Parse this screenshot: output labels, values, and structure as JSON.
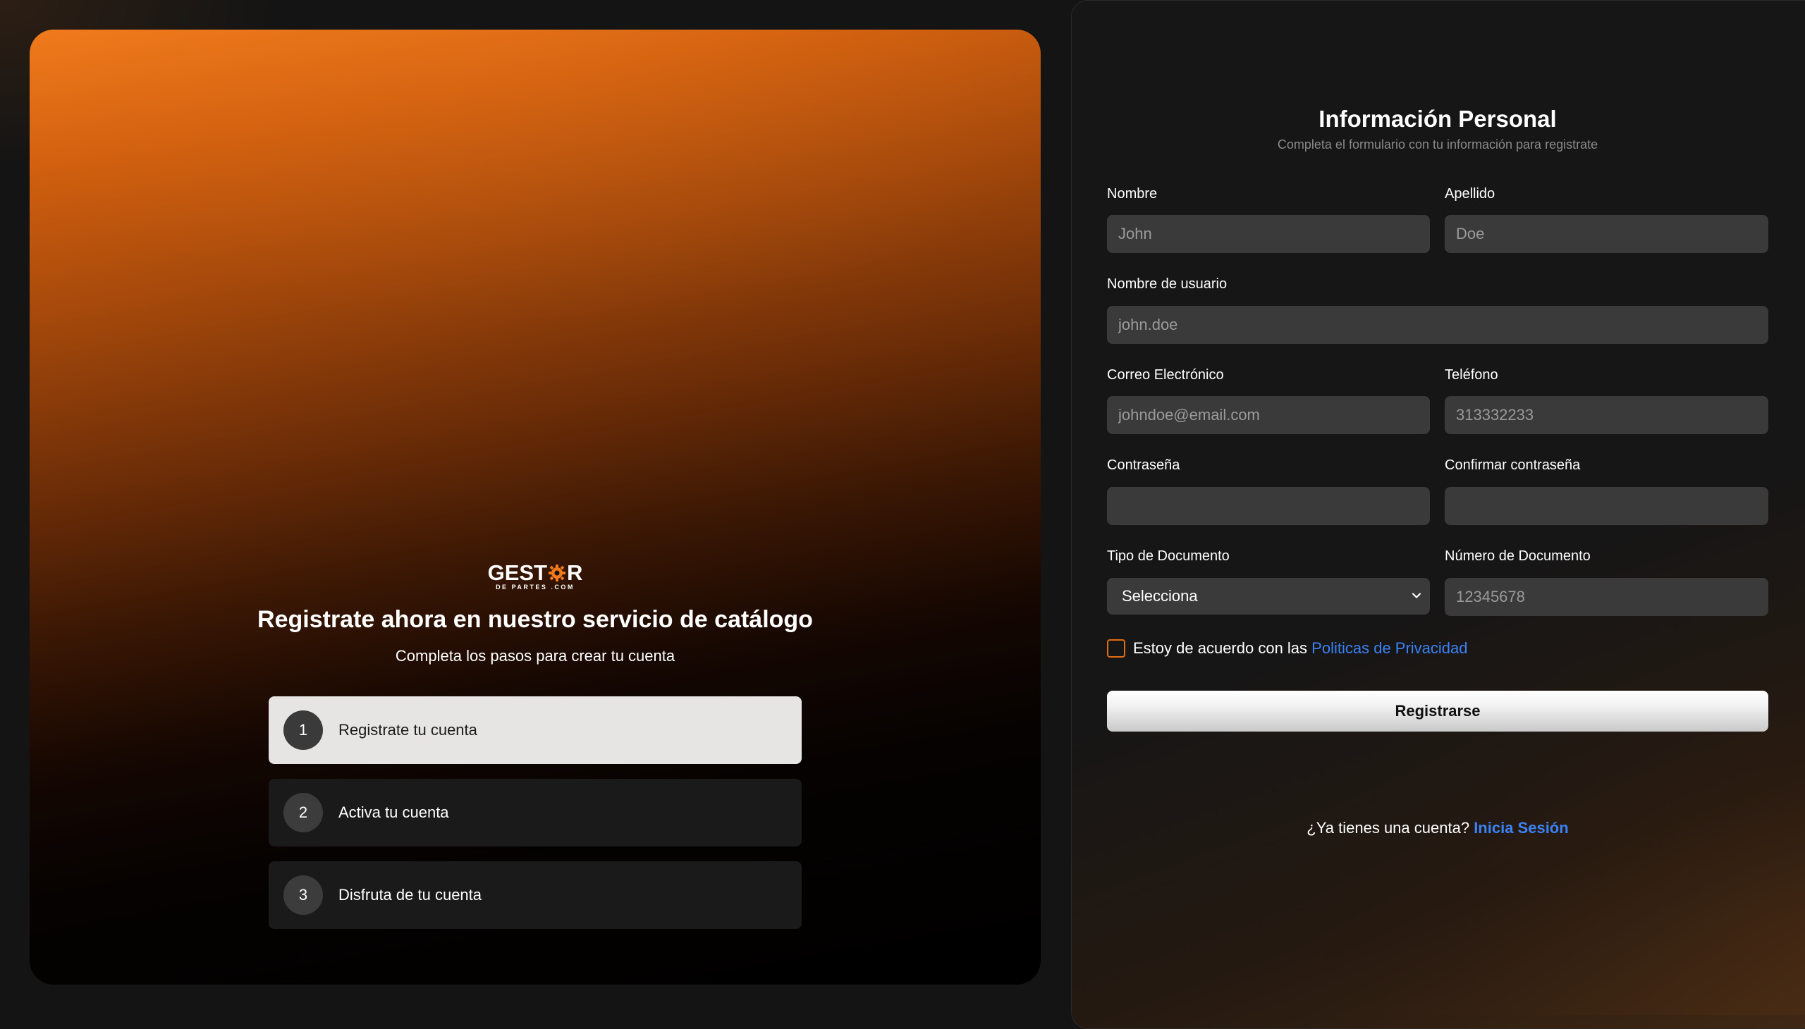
{
  "hero": {
    "logo_text": "GESTOR",
    "logo_sub": "DE PARTES .COM",
    "title": "Registrate ahora en nuestro servicio de catálogo",
    "subtitle": "Completa los pasos para crear tu cuenta",
    "steps": [
      {
        "num": "1",
        "label": "Registrate tu cuenta",
        "active": true
      },
      {
        "num": "2",
        "label": "Activa tu cuenta",
        "active": false
      },
      {
        "num": "3",
        "label": "Disfruta de tu cuenta",
        "active": false
      }
    ]
  },
  "form": {
    "title": "Información Personal",
    "subtitle": "Completa el formulario con tu información para registrate",
    "fields": {
      "first_name": {
        "label": "Nombre",
        "placeholder": "John"
      },
      "last_name": {
        "label": "Apellido",
        "placeholder": "Doe"
      },
      "username": {
        "label": "Nombre de usuario",
        "placeholder": "john.doe"
      },
      "email": {
        "label": "Correo Electrónico",
        "placeholder": "johndoe@email.com"
      },
      "phone": {
        "label": "Teléfono",
        "placeholder": "313332233"
      },
      "password": {
        "label": "Contraseña",
        "placeholder": ""
      },
      "confirm_password": {
        "label": "Confirmar contraseña",
        "placeholder": ""
      },
      "doc_type": {
        "label": "Tipo de Documento",
        "value": "Selecciona"
      },
      "doc_number": {
        "label": "Número de Documento",
        "placeholder": "12345678"
      }
    },
    "privacy_text": "Estoy de acuerdo con las",
    "privacy_link": "Politicas de Privacidad",
    "register_label": "Registrarse",
    "login_prompt": "¿Ya tienes una cuenta?",
    "login_link": "Inicia Sesión"
  },
  "colors": {
    "accent_orange": "#e06d16",
    "link_blue": "#3b82f6",
    "panel_bg": "#161616",
    "input_bg": "#3a3a3a"
  }
}
